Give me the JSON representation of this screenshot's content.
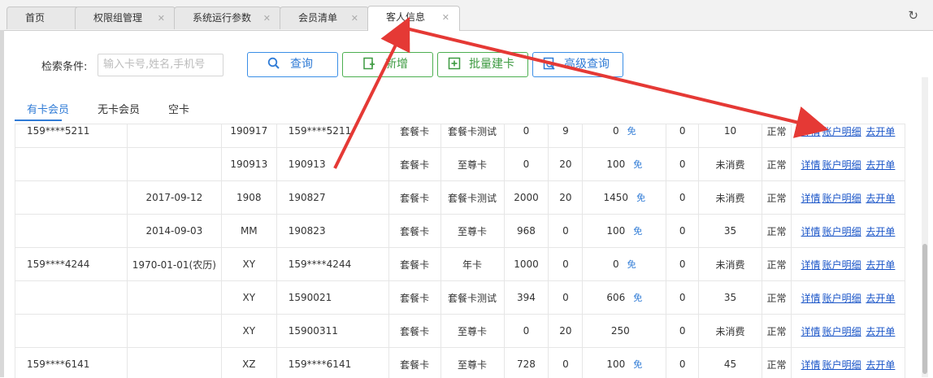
{
  "tabs": [
    {
      "label": "首页",
      "closable": false
    },
    {
      "label": "权限组管理",
      "closable": true
    },
    {
      "label": "系统运行参数",
      "closable": true
    },
    {
      "label": "会员清单",
      "closable": true
    },
    {
      "label": "客人信息",
      "closable": true,
      "active": true
    }
  ],
  "search": {
    "label": "检索条件:",
    "placeholder": "输入卡号,姓名,手机号"
  },
  "toolbar": {
    "query_label": "查询",
    "add_label": "新增",
    "batch_label": "批量建卡",
    "advanced_label": "高级查询"
  },
  "subtabs": [
    "有卡会员",
    "无卡会员",
    "空卡"
  ],
  "rows": [
    {
      "c1": "159****5211",
      "c2": "",
      "c3": "190917",
      "c4": "159****5211",
      "c5": "套餐卡",
      "c6": "套餐卡测试",
      "c7": "0",
      "c8": "9",
      "c9": "0",
      "mian": "免",
      "c10": "0",
      "c11": "10",
      "c12": "正常"
    },
    {
      "c1": "",
      "c2": "",
      "c3": "190913",
      "c4": "190913",
      "c5": "套餐卡",
      "c6": "至尊卡",
      "c7": "0",
      "c8": "20",
      "c9": "100",
      "mian": "免",
      "c10": "0",
      "c11": "未消费",
      "c12": "正常"
    },
    {
      "c1": "",
      "c2": "2017-09-12",
      "c3": "1908",
      "c4": "190827",
      "c5": "套餐卡",
      "c6": "套餐卡测试",
      "c7": "2000",
      "c8": "20",
      "c9": "1450",
      "mian": "免",
      "c10": "0",
      "c11": "未消费",
      "c12": "正常"
    },
    {
      "c1": "",
      "c2": "2014-09-03",
      "c3": "MM",
      "c4": "190823",
      "c5": "套餐卡",
      "c6": "至尊卡",
      "c7": "968",
      "c8": "0",
      "c9": "100",
      "mian": "免",
      "c10": "0",
      "c11": "35",
      "c12": "正常"
    },
    {
      "c1": "159****4244",
      "c2": "1970-01-01(农历)",
      "c3": "XY",
      "c4": "159****4244",
      "c5": "套餐卡",
      "c6": "年卡",
      "c7": "1000",
      "c8": "0",
      "c9": "0",
      "mian": "免",
      "c10": "0",
      "c11": "未消费",
      "c12": "正常"
    },
    {
      "c1": "",
      "c2": "",
      "c3": "XY",
      "c4": "1590021",
      "c5": "套餐卡",
      "c6": "套餐卡测试",
      "c7": "394",
      "c8": "0",
      "c9": "606",
      "mian": "免",
      "c10": "0",
      "c11": "35",
      "c12": "正常"
    },
    {
      "c1": "",
      "c2": "",
      "c3": "XY",
      "c4": "15900311",
      "c5": "套餐卡",
      "c6": "至尊卡",
      "c7": "0",
      "c8": "20",
      "c9": "250",
      "mian": "",
      "c10": "0",
      "c11": "未消费",
      "c12": "正常"
    },
    {
      "c1": "159****6141",
      "c2": "",
      "c3": "XZ",
      "c4": "159****6141",
      "c5": "套餐卡",
      "c6": "至尊卡",
      "c7": "728",
      "c8": "0",
      "c9": "100",
      "mian": "免",
      "c10": "0",
      "c11": "45",
      "c12": "正常"
    }
  ],
  "row_actions": {
    "detail": "详情",
    "account": "账户明细",
    "bill": "去开单"
  }
}
